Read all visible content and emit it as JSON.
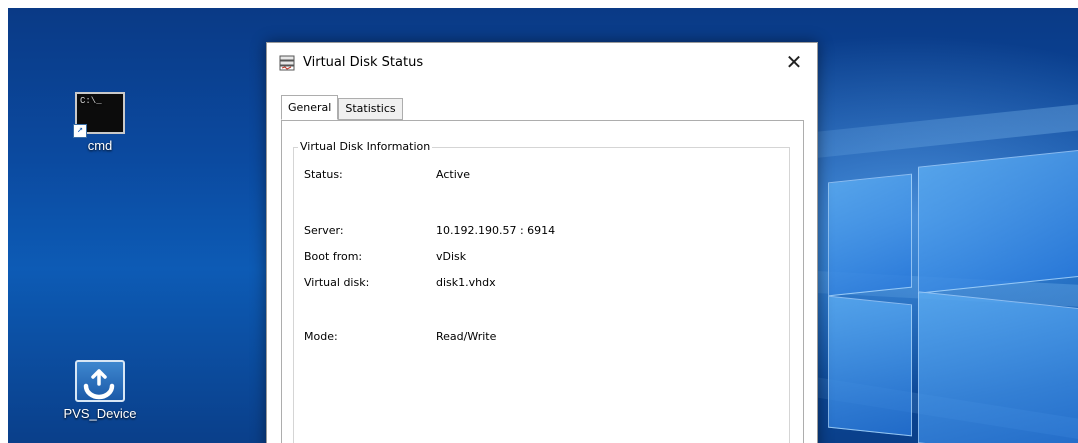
{
  "desktop": {
    "icons": [
      {
        "label": "cmd",
        "glyph_text": "C:\\_"
      },
      {
        "label": "PVS_Device"
      }
    ]
  },
  "dialog": {
    "title": "Virtual Disk Status",
    "close_glyph": "✕",
    "tabs": [
      {
        "label": "General",
        "active": true
      },
      {
        "label": "Statistics",
        "active": false
      }
    ],
    "group_title": "Virtual Disk Information",
    "rows": [
      {
        "label": "Status:",
        "value": "Active"
      },
      {
        "label": "Server:",
        "value": "10.192.190.57 : 6914"
      },
      {
        "label": "Boot from:",
        "value": "vDisk"
      },
      {
        "label": "Virtual disk:",
        "value": "disk1.vhdx"
      },
      {
        "label": "Mode:",
        "value": "Read/Write"
      }
    ]
  },
  "colors": {
    "wallpaper_dark": "#0a3a86",
    "wallpaper_light": "#78beff",
    "dialog_bg": "#ffffff",
    "tab_border": "#adadad"
  }
}
